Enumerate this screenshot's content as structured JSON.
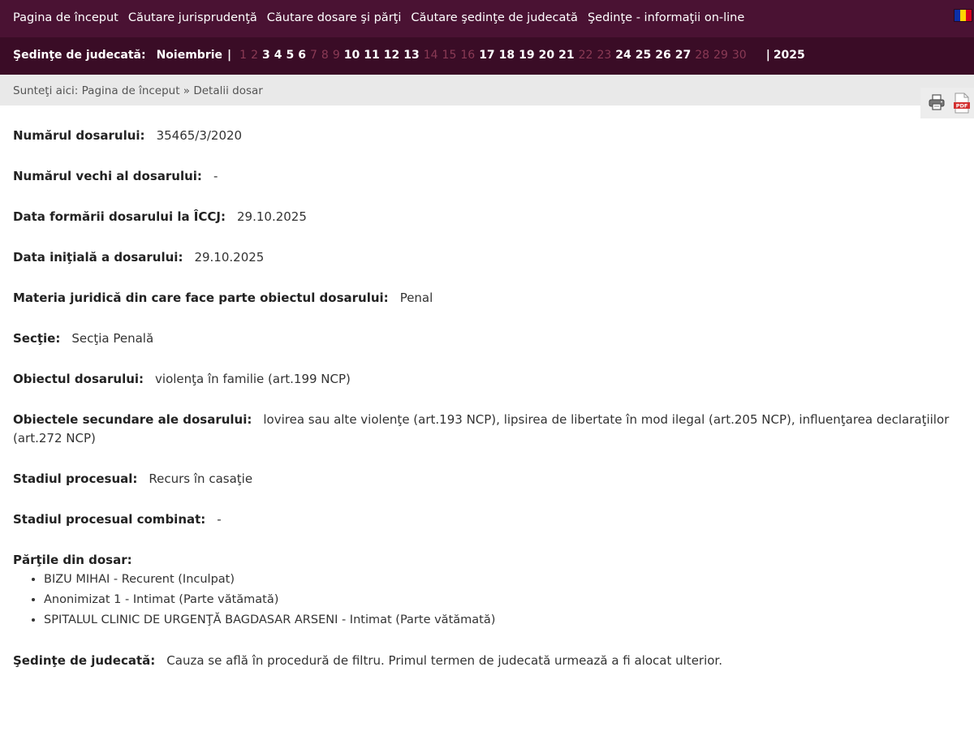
{
  "nav": {
    "links": [
      "Pagina de început",
      "Căutare jurisprudenţă",
      "Căutare dosare şi părţi",
      "Căutare şedinţe de judecată",
      "Şedinţe - informaţii on-line"
    ],
    "flag_colors": [
      "#0b2fa8",
      "#ffd400",
      "#d5001f"
    ]
  },
  "sessions_bar": {
    "label": "Şedinţe de judecată:",
    "month": "Noiembrie",
    "separator": "|",
    "days": [
      {
        "d": "1",
        "active": false
      },
      {
        "d": "2",
        "active": false
      },
      {
        "d": "3",
        "active": true
      },
      {
        "d": "4",
        "active": true
      },
      {
        "d": "5",
        "active": true
      },
      {
        "d": "6",
        "active": true
      },
      {
        "d": "7",
        "active": false
      },
      {
        "d": "8",
        "active": false
      },
      {
        "d": "9",
        "active": false
      },
      {
        "d": "10",
        "active": true
      },
      {
        "d": "11",
        "active": true
      },
      {
        "d": "12",
        "active": true
      },
      {
        "d": "13",
        "active": true
      },
      {
        "d": "14",
        "active": false
      },
      {
        "d": "15",
        "active": false
      },
      {
        "d": "16",
        "active": false
      },
      {
        "d": "17",
        "active": true
      },
      {
        "d": "18",
        "active": true
      },
      {
        "d": "19",
        "active": true
      },
      {
        "d": "20",
        "active": true
      },
      {
        "d": "21",
        "active": true
      },
      {
        "d": "22",
        "active": false
      },
      {
        "d": "23",
        "active": false
      },
      {
        "d": "24",
        "active": true
      },
      {
        "d": "25",
        "active": true
      },
      {
        "d": "26",
        "active": true
      },
      {
        "d": "27",
        "active": true
      },
      {
        "d": "28",
        "active": false
      },
      {
        "d": "29",
        "active": false
      },
      {
        "d": "30",
        "active": false
      }
    ],
    "year": "2025"
  },
  "breadcrumb": {
    "text": "Sunteţi aici: Pagina de început » Detalii dosar"
  },
  "toolbar": {
    "print_icon": "printer-icon",
    "pdf_icon": "pdf-icon",
    "pdf_label": "PDF"
  },
  "dosar": {
    "numar": {
      "label": "Numărul dosarului:",
      "value": "35465/3/2020"
    },
    "numar_vechi": {
      "label": "Numărul vechi al dosarului:",
      "value": "-"
    },
    "data_formarii": {
      "label": "Data formării dosarului la ÎCCJ:",
      "value": "29.10.2025"
    },
    "data_initiala": {
      "label": "Data iniţială a dosarului:",
      "value": "29.10.2025"
    },
    "materia": {
      "label": "Materia juridică din care face parte obiectul dosarului:",
      "value": "Penal"
    },
    "sectie": {
      "label": "Secţie:",
      "value": "Secţia Penală"
    },
    "obiect": {
      "label": "Obiectul dosarului:",
      "value": "violenţa în familie (art.199 NCP)"
    },
    "obiecte_secundare": {
      "label": "Obiectele secundare ale dosarului:",
      "value": "lovirea sau alte violenţe (art.193 NCP), lipsirea de libertate în mod ilegal (art.205 NCP), influenţarea declaraţiilor (art.272 NCP)"
    },
    "stadiu": {
      "label": "Stadiul procesual:",
      "value": "Recurs în casaţie"
    },
    "stadiu_combinat": {
      "label": "Stadiul procesual combinat:",
      "value": "-"
    },
    "parti": {
      "label": "Părţile din dosar:",
      "items": [
        "BIZU MIHAI - Recurent (Inculpat)",
        "Anonimizat 1 - Intimat (Parte vătămată)",
        "SPITALUL CLINIC DE URGENŢĂ BAGDASAR ARSENI - Intimat (Parte vătămată)"
      ]
    },
    "sedinte": {
      "label": "Şedinţe de judecată:",
      "value": "Cauza se află în procedură de filtru. Primul termen de judecată urmează a fi alocat ulterior."
    }
  }
}
